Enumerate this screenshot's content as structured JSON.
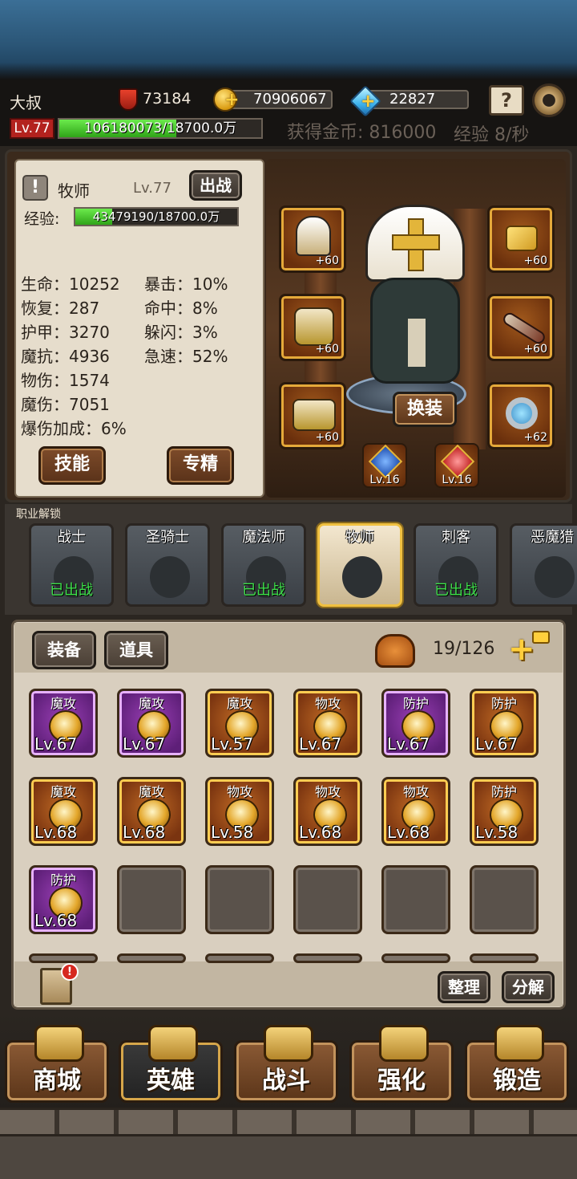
{
  "player": {
    "name": "大叔",
    "level": "Lv.77",
    "exp_text": "106180073/18700.0万",
    "exp_fraction": 0.58
  },
  "resources": {
    "power": "73184",
    "gold": "70906067",
    "diamond": "22827"
  },
  "rates": {
    "gold_label": "获得金币: 816000",
    "exp_label": "经验 8/秒"
  },
  "hero": {
    "alert": "!",
    "class_name": "牧师",
    "level": "Lv.77",
    "deploy_button": "出战",
    "exp_label": "经验:",
    "exp_text": "43479190/18700.0万",
    "exp_fraction": 0.23,
    "stats_left": [
      "生命：10252",
      "恢复：287",
      "护甲：3270",
      "魔抗：4936",
      "物伤：1574",
      "魔伤：7051",
      "爆伤加成：6%"
    ],
    "stats_right": [
      "暴击：10%",
      "命中：8%",
      "躲闪：3%",
      "急速：52%"
    ],
    "skill_button": "技能",
    "specialize_button": "专精",
    "change_outfit_button": "换装"
  },
  "equipment_slots": [
    {
      "name": "helmet",
      "level": "+60"
    },
    {
      "name": "charm",
      "level": "+60"
    },
    {
      "name": "armor",
      "level": "+60"
    },
    {
      "name": "weapon",
      "level": "+60"
    },
    {
      "name": "boots",
      "level": "+60"
    },
    {
      "name": "ring",
      "level": "+62"
    }
  ],
  "gems": [
    {
      "level": "Lv.16"
    },
    {
      "level": "Lv.16"
    }
  ],
  "class_unlock": {
    "title": "职业解锁",
    "classes": [
      {
        "name": "战士",
        "status": "已出战",
        "selected": false
      },
      {
        "name": "圣骑士",
        "status": "",
        "selected": false
      },
      {
        "name": "魔法师",
        "status": "已出战",
        "selected": false
      },
      {
        "name": "牧师",
        "status": "",
        "selected": true
      },
      {
        "name": "刺客",
        "status": "已出战",
        "selected": false
      },
      {
        "name": "恶魔猎",
        "status": "",
        "selected": false
      }
    ]
  },
  "inventory": {
    "tab_equipment": "装备",
    "tab_items": "道具",
    "capacity": "19/126",
    "sort_button": "整理",
    "dismantle_button": "分解",
    "notice_badge": "!",
    "rows": [
      [
        {
          "cat": "魔攻",
          "level": "Lv.67",
          "rarity": "purple",
          "icon": "gem-amulet-icon"
        },
        {
          "cat": "魔攻",
          "level": "Lv.67",
          "rarity": "purple",
          "icon": "gem-amulet-icon"
        },
        {
          "cat": "魔攻",
          "level": "Lv.57",
          "rarity": "orange",
          "icon": "pendant-icon"
        },
        {
          "cat": "物攻",
          "level": "Lv.67",
          "rarity": "orange",
          "icon": "book-icon"
        },
        {
          "cat": "防护",
          "level": "Lv.67",
          "rarity": "purple",
          "icon": "gold-shard-icon"
        },
        {
          "cat": "防护",
          "level": "Lv.67",
          "rarity": "orange",
          "icon": "gold-shard-icon"
        }
      ],
      [
        {
          "cat": "魔攻",
          "level": "Lv.68",
          "rarity": "orange",
          "icon": "emerald-ring-icon"
        },
        {
          "cat": "魔攻",
          "level": "Lv.68",
          "rarity": "orange",
          "icon": "emerald-ring-icon"
        },
        {
          "cat": "物攻",
          "level": "Lv.58",
          "rarity": "orange",
          "icon": "silver-ring-icon"
        },
        {
          "cat": "物攻",
          "level": "Lv.68",
          "rarity": "orange",
          "icon": "ruby-ring-icon"
        },
        {
          "cat": "物攻",
          "level": "Lv.68",
          "rarity": "orange",
          "icon": "ruby-ring-icon"
        },
        {
          "cat": "防护",
          "level": "Lv.58",
          "rarity": "orange",
          "icon": "flower-ring-icon"
        }
      ],
      [
        {
          "cat": "防护",
          "level": "Lv.68",
          "rarity": "purple",
          "icon": "rose-ring-icon"
        },
        {
          "cat": "",
          "level": "",
          "rarity": "empty",
          "icon": ""
        },
        {
          "cat": "",
          "level": "",
          "rarity": "empty",
          "icon": ""
        },
        {
          "cat": "",
          "level": "",
          "rarity": "empty",
          "icon": ""
        },
        {
          "cat": "",
          "level": "",
          "rarity": "empty",
          "icon": ""
        },
        {
          "cat": "",
          "level": "",
          "rarity": "empty",
          "icon": ""
        }
      ]
    ]
  },
  "nav": [
    {
      "label": "商城",
      "icon": "treasure-chest-icon",
      "selected": false
    },
    {
      "label": "英雄",
      "icon": "viking-helmet-icon",
      "selected": true
    },
    {
      "label": "战斗",
      "icon": "crossed-swords-icon",
      "selected": false
    },
    {
      "label": "强化",
      "icon": "hammer-icon",
      "selected": false
    },
    {
      "label": "锻造",
      "icon": "forge-icon",
      "selected": false
    }
  ],
  "colors": {
    "exp_bar": "#3fcf2a",
    "level_badge": "#b3221e",
    "selected_border": "#f0c040",
    "deployed_text": "#3ee04a"
  }
}
